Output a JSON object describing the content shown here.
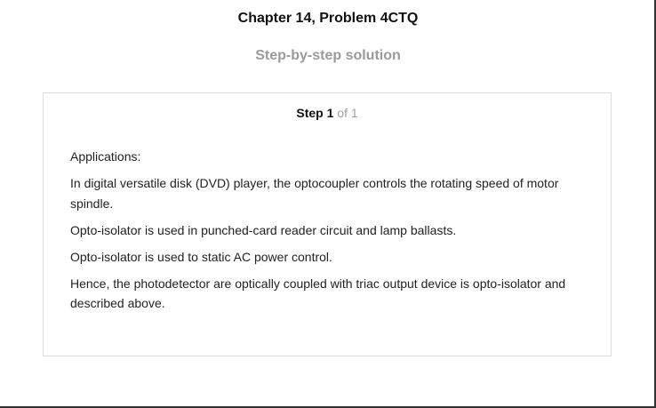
{
  "header": {
    "title": "Chapter 14, Problem 4CTQ",
    "subtitle": "Step-by-step solution"
  },
  "step": {
    "word": "Step",
    "number": "1",
    "of_text": "of 1"
  },
  "solution": {
    "paragraphs": [
      "Applications:",
      "In digital versatile disk (DVD) player, the optocoupler controls the rotating speed of motor spindle.",
      "Opto-isolator is used in punched-card reader circuit and lamp ballasts.",
      "Opto-isolator is used to static AC power control.",
      "Hence, the photodetector are optically coupled with triac output device is opto-isolator and described above."
    ]
  },
  "colors": {
    "subtitle": "#9a9a9a",
    "card_border": "#dcdcdc",
    "step_muted": "#a0a0a0"
  }
}
